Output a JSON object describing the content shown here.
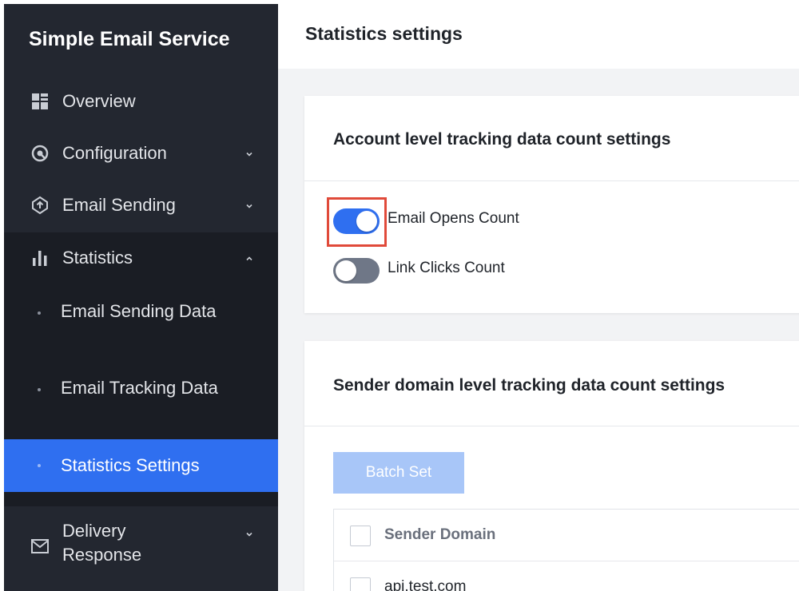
{
  "sidebar": {
    "brand": "Simple Email Service",
    "items": [
      {
        "label": "Overview",
        "icon": "grid-icon"
      },
      {
        "label": "Configuration",
        "icon": "gear-icon",
        "expanded": false
      },
      {
        "label": "Email Sending",
        "icon": "upload-icon",
        "expanded": false
      },
      {
        "label": "Statistics",
        "icon": "bar-chart-icon",
        "expanded": true
      },
      {
        "label": "Delivery Response",
        "icon": "mail-icon",
        "expanded": false
      }
    ],
    "statistics_sub": [
      {
        "label": "Email Sending Data",
        "active": false
      },
      {
        "label": "Email Tracking Data",
        "active": false
      },
      {
        "label": "Statistics Settings",
        "active": true
      }
    ]
  },
  "header": {
    "title": "Statistics settings"
  },
  "account_card": {
    "title": "Account level tracking data count settings",
    "toggles": [
      {
        "label": "Email Opens Count",
        "on": true
      },
      {
        "label": "Link Clicks Count",
        "on": false
      }
    ]
  },
  "domain_card": {
    "title": "Sender domain level tracking data count settings",
    "batch_button": "Batch Set",
    "table": {
      "header": "Sender Domain",
      "rows": [
        "api.test.com"
      ]
    }
  },
  "colors": {
    "sidebar_bg": "#232730",
    "accent": "#2f6ff0",
    "highlight": "#e04a3a"
  }
}
